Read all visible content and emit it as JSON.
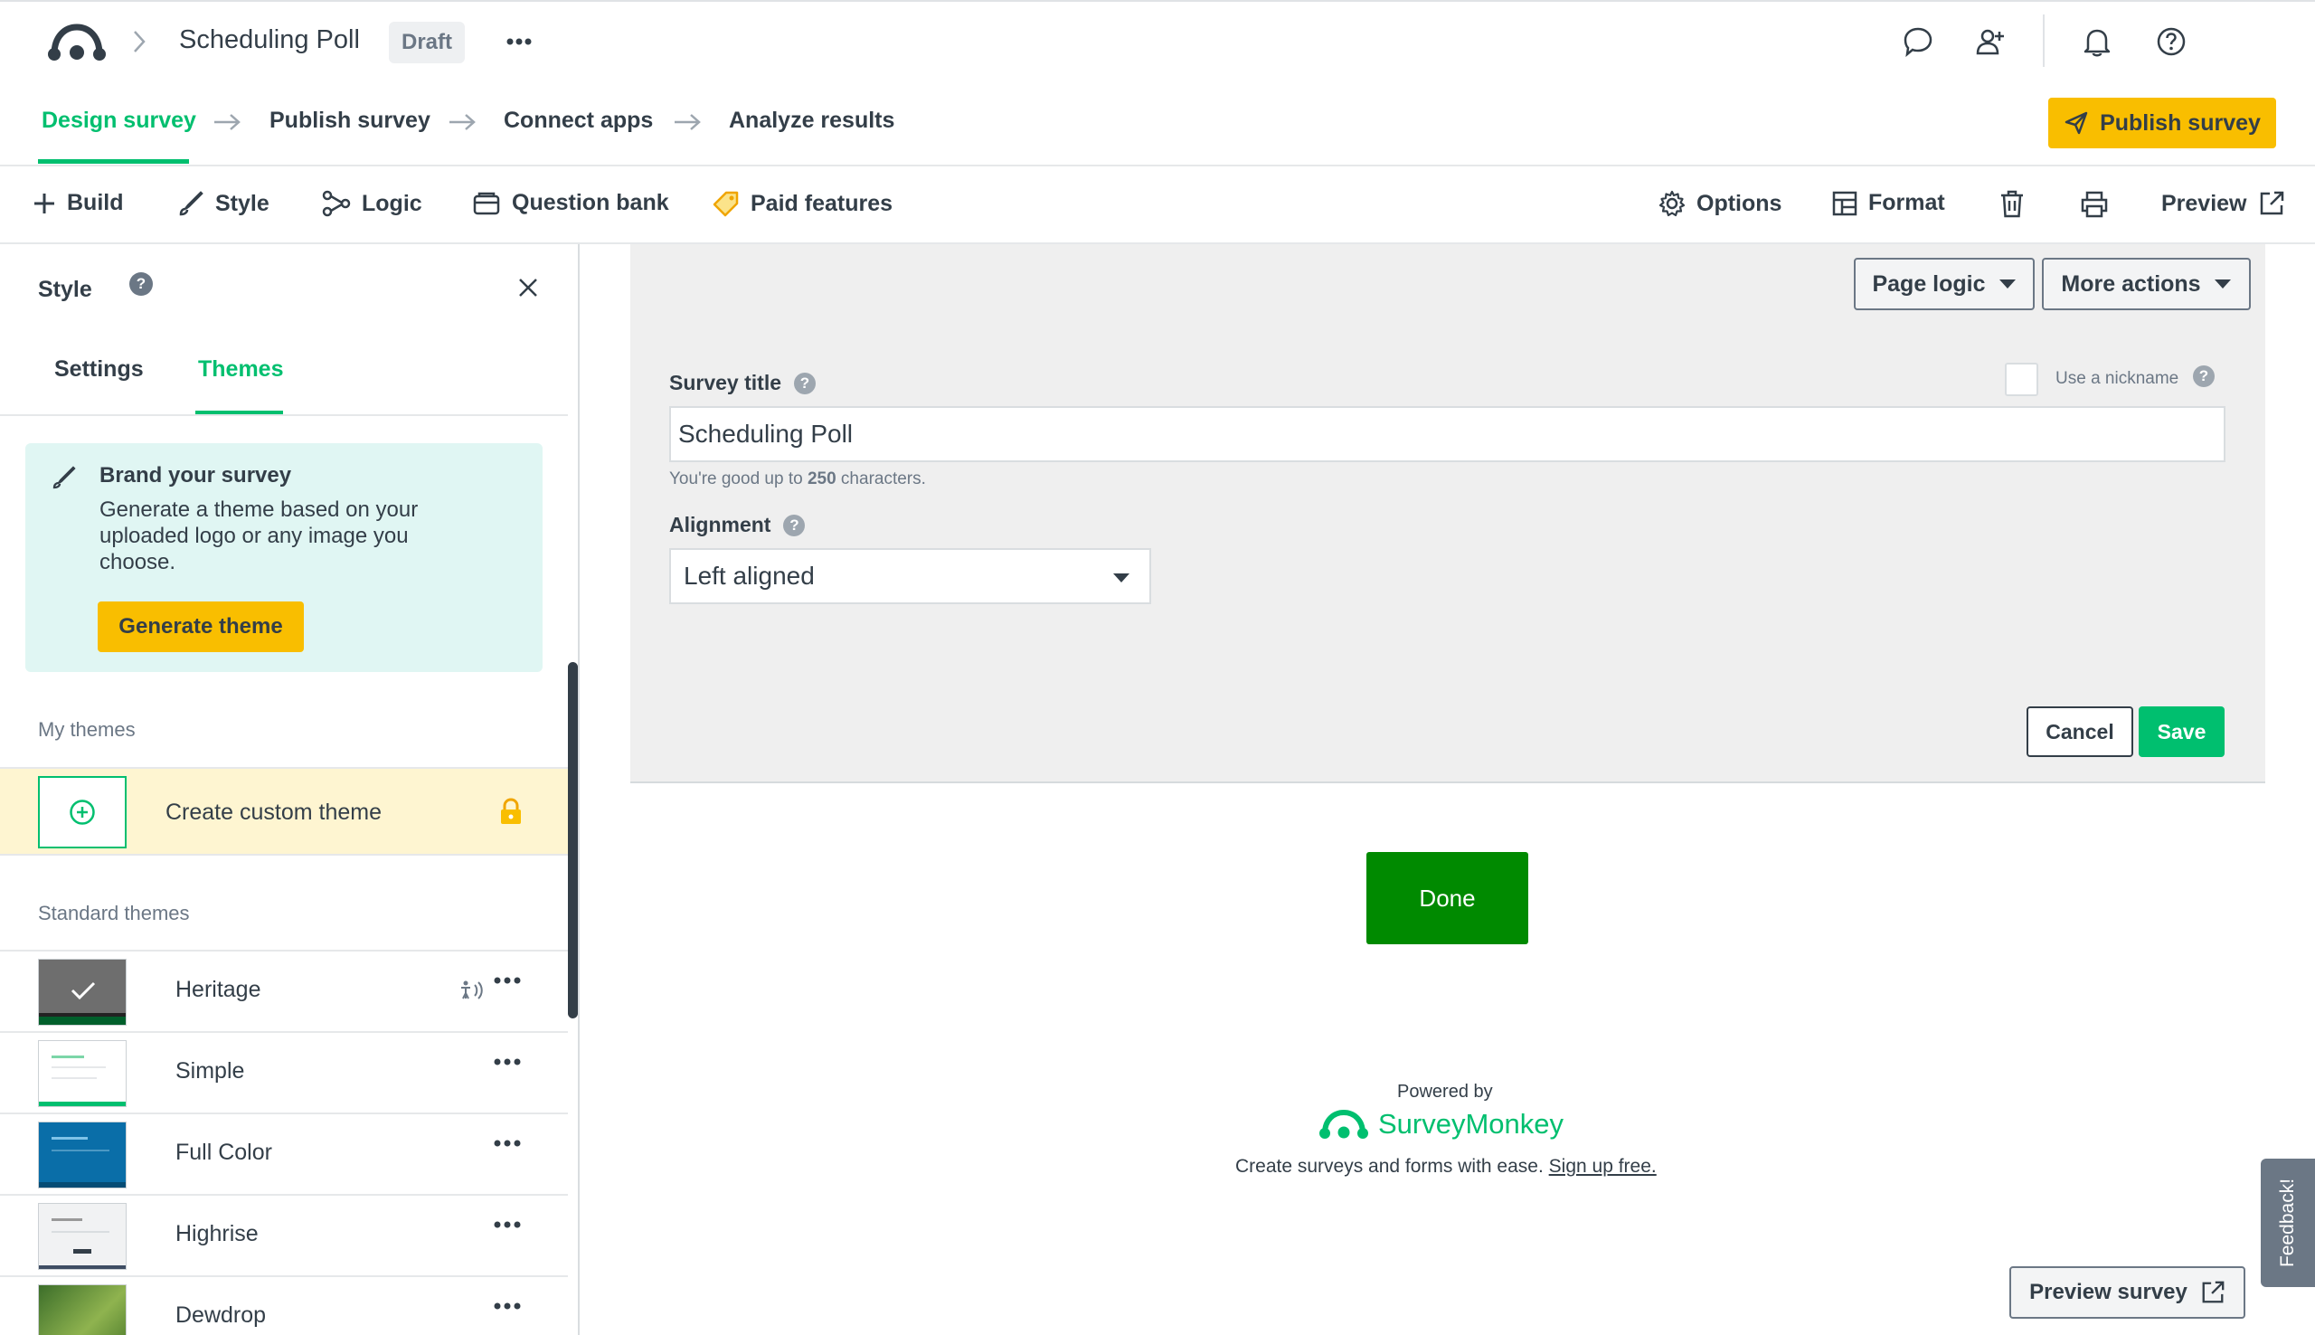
{
  "header": {
    "title": "Scheduling Poll",
    "status_badge": "Draft",
    "more_label": "•••"
  },
  "steps": {
    "items": [
      {
        "label": "Design survey",
        "active": true
      },
      {
        "label": "Publish survey",
        "active": false
      },
      {
        "label": "Connect apps",
        "active": false
      },
      {
        "label": "Analyze results",
        "active": false
      }
    ],
    "publish_button": "Publish survey"
  },
  "toolbar": {
    "build": "Build",
    "style": "Style",
    "logic": "Logic",
    "question_bank": "Question bank",
    "paid_features": "Paid features",
    "options": "Options",
    "format": "Format",
    "preview": "Preview"
  },
  "style_panel": {
    "title": "Style",
    "tabs": [
      "Settings",
      "Themes"
    ],
    "active_tab": "Themes",
    "brand_card": {
      "title": "Brand your survey",
      "line1": "Generate a theme based on your",
      "line2": "uploaded logo or any image you",
      "line3": "choose.",
      "button": "Generate theme"
    },
    "my_themes_label": "My themes",
    "create_custom_theme": "Create custom theme",
    "standard_themes_label": "Standard themes",
    "themes": [
      {
        "name": "Heritage",
        "selected": true
      },
      {
        "name": "Simple",
        "selected": false
      },
      {
        "name": "Full Color",
        "selected": false
      },
      {
        "name": "Highrise",
        "selected": false
      },
      {
        "name": "Dewdrop",
        "selected": false
      }
    ]
  },
  "editor": {
    "page_logic": "Page logic",
    "more_actions": "More actions",
    "survey_title_label": "Survey title",
    "use_nickname_label": "Use a nickname",
    "survey_title_value": "Scheduling Poll",
    "hint_prefix": "You're good up to ",
    "hint_count": "250",
    "hint_suffix": " characters.",
    "alignment_label": "Alignment",
    "alignment_value": "Left aligned",
    "cancel": "Cancel",
    "save": "Save"
  },
  "survey_preview": {
    "done_button": "Done",
    "powered_by": "Powered by",
    "brand": "SurveyMonkey",
    "footer_text": "Create surveys and forms with ease. ",
    "signup_link": "Sign up free.",
    "feedback": "Feedback!",
    "preview_survey": "Preview survey"
  },
  "colors": {
    "accent_green": "#00bf6f",
    "publish_yellow": "#f9be00",
    "done_green": "#008a00",
    "brand_card_bg": "#e0f6f3",
    "custom_theme_bg": "#fef5d1"
  }
}
